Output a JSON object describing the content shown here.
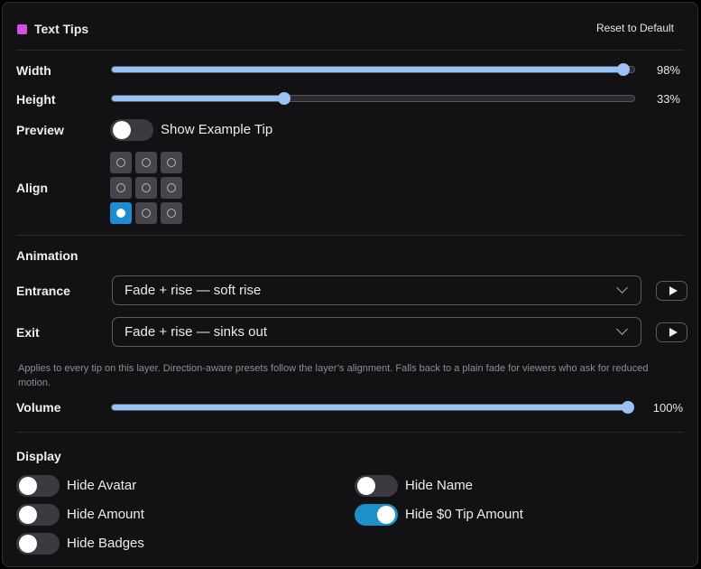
{
  "header": {
    "title": "Text Tips",
    "reset_label": "Reset to Default",
    "accent": "#d84fe0"
  },
  "sizing": {
    "width": {
      "label": "Width",
      "value": 98,
      "display": "98%"
    },
    "height": {
      "label": "Height",
      "value": 33,
      "display": "33%"
    }
  },
  "preview": {
    "label": "Preview",
    "toggle_label": "Show Example Tip",
    "on": false
  },
  "align": {
    "label": "Align",
    "selected_row": 2,
    "selected_col": 0
  },
  "animation": {
    "section": "Animation",
    "entrance": {
      "label": "Entrance",
      "value": "Fade + rise — soft rise"
    },
    "exit": {
      "label": "Exit",
      "value": "Fade + rise — sinks out"
    },
    "note": "Applies to every tip on this layer. Direction-aware presets follow the layer’s alignment. Falls back to a plain fade for viewers who ask for reduced motion.",
    "volume": {
      "label": "Volume",
      "value": 100,
      "display": "100%"
    }
  },
  "display": {
    "section": "Display",
    "hide_avatar": {
      "label": "Hide Avatar",
      "on": false
    },
    "hide_name": {
      "label": "Hide Name",
      "on": false
    },
    "hide_amount": {
      "label": "Hide Amount",
      "on": false
    },
    "hide_zero_tip": {
      "label": "Hide $0 Tip Amount",
      "on": true
    },
    "hide_badges": {
      "label": "Hide Badges",
      "on": false
    }
  },
  "colors": {
    "slider_fill": "#9bc1f6",
    "toggle_on": "#1e90c8",
    "align_selected": "#1f8bd0"
  }
}
